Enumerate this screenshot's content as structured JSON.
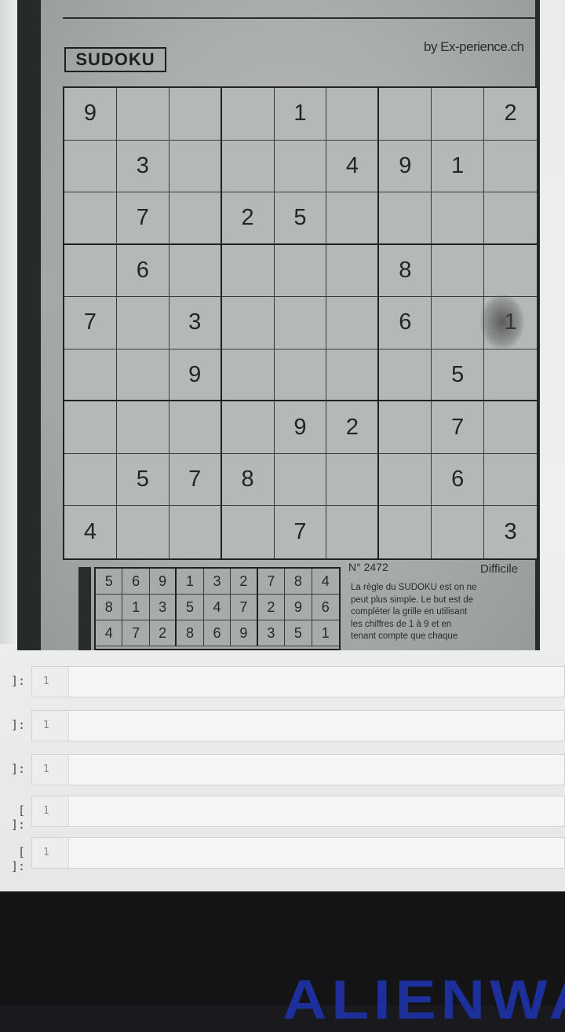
{
  "newspaper": {
    "title": "SUDOKU",
    "byline": "by Ex-perience.ch",
    "puzzle_number": "N° 2472",
    "difficulty": "Difficile",
    "rules_lines": [
      "La règle du SUDOKU est on ne",
      "peut plus simple. Le but est de",
      "compléter la grille en utilisant",
      "les chiffres de 1 à 9 et en",
      "tenant compte que chaque"
    ]
  },
  "puzzle": [
    [
      "9",
      "",
      "",
      "",
      "1",
      "",
      "",
      "",
      "2"
    ],
    [
      "",
      "3",
      "",
      "",
      "",
      "4",
      "9",
      "1",
      ""
    ],
    [
      "",
      "7",
      "",
      "2",
      "5",
      "",
      "",
      "",
      ""
    ],
    [
      "",
      "6",
      "",
      "",
      "",
      "",
      "8",
      "",
      ""
    ],
    [
      "7",
      "",
      "3",
      "",
      "",
      "",
      "6",
      "",
      "1"
    ],
    [
      "",
      "",
      "9",
      "",
      "",
      "",
      "",
      "5",
      ""
    ],
    [
      "",
      "",
      "",
      "",
      "9",
      "2",
      "",
      "7",
      ""
    ],
    [
      "",
      "5",
      "7",
      "8",
      "",
      "",
      "",
      "6",
      ""
    ],
    [
      "4",
      "",
      "",
      "",
      "7",
      "",
      "",
      "",
      "3"
    ]
  ],
  "solution": [
    [
      "5",
      "6",
      "9",
      "1",
      "3",
      "2",
      "7",
      "8",
      "4"
    ],
    [
      "8",
      "1",
      "3",
      "5",
      "4",
      "7",
      "2",
      "9",
      "6"
    ],
    [
      "4",
      "7",
      "2",
      "8",
      "6",
      "9",
      "3",
      "5",
      "1"
    ]
  ],
  "notebook_cells": [
    {
      "prompt": "]:",
      "line": "1"
    },
    {
      "prompt": "]:",
      "line": "1"
    },
    {
      "prompt": "]:",
      "line": "1"
    },
    {
      "prompt": "[ ]:",
      "line": "1"
    },
    {
      "prompt": "[ ]:",
      "line": "1"
    }
  ],
  "monitor_brand": "ALIENWARE"
}
